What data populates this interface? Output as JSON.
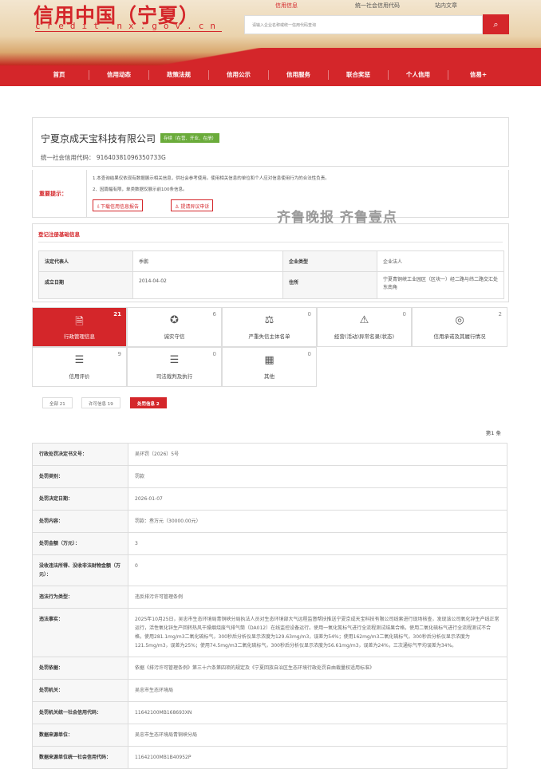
{
  "header": {
    "logo": "信用中国（宁夏）",
    "logo_sub": "credit.nx.gov.cn",
    "search_tabs": [
      "信用信息",
      "统一社会信用代码",
      "站内文章"
    ],
    "search_placeholder": "请输入企业名称或统一信用代码查询"
  },
  "nav": [
    "首页",
    "信用动态",
    "政策法规",
    "信用公示",
    "信用服务",
    "联合奖惩",
    "个人信用",
    "信易+"
  ],
  "company": {
    "name": "宁夏京成天宝科技有限公司",
    "status": "存续（在营、开业、在册）",
    "code_label": "统一社会信用代码：",
    "code": "91640381096350733G"
  },
  "notice": {
    "label": "重要提示：",
    "lines": [
      "1.本查询结果仅依现有数据展示相关信息，供社会参考使用。使用相关信息的单位和个人应对信息使用行为的合法性负责。",
      "2、因篇幅有限，单类数据仅展示前100条信息。"
    ],
    "download": "下载信用信息报告",
    "objection": "提请异议申诉"
  },
  "watermark": "齐鲁晚报  齐鲁壹点",
  "basic": {
    "title": "登记注册基础信息",
    "rows": [
      [
        "法定代表人",
        "季鹏",
        "企业类型",
        "企业法人"
      ],
      [
        "成立日期",
        "2014-04-02",
        "住所",
        "宁夏青铜峡工业园区（区块一）经二路与纬二路交汇处东南角"
      ]
    ]
  },
  "tiles": [
    {
      "label": "行政管理信息",
      "count": "21",
      "icon": "document-person-icon"
    },
    {
      "label": "诚实守信",
      "count": "6",
      "icon": "medal-icon"
    },
    {
      "label": "严重失信主体名单",
      "count": "0",
      "icon": "gavel-icon"
    },
    {
      "label": "经营(活动)异常名录(状态)",
      "count": "0",
      "icon": "alarm-icon"
    },
    {
      "label": "信用承诺及其履行情况",
      "count": "2",
      "icon": "target-icon"
    },
    {
      "label": "信用评价",
      "count": "9",
      "icon": "person-list-icon"
    },
    {
      "label": "司法裁判及执行",
      "count": "0",
      "icon": "person-list-icon"
    },
    {
      "label": "其他",
      "count": "0",
      "icon": "file-grid-icon"
    }
  ],
  "filters": [
    "全部 21",
    "许可信息 19",
    "处罚信息 2"
  ],
  "page_label": "第1 条",
  "detail": [
    [
      "行政处罚决定书文号：",
      "吴环罚〔2026〕5号"
    ],
    [
      "处罚类别：",
      "罚款"
    ],
    [
      "处罚决定日期：",
      "2026-01-07"
    ],
    [
      "处罚内容：",
      "罚款：叁万元（30000.00元）"
    ],
    [
      "处罚金额（万元）：",
      "3"
    ],
    [
      "没收违法所得、没收非法财物金额（万元）：",
      "0"
    ],
    [
      "违法行为类型：",
      "违反排污许可管理条例"
    ],
    [
      "违法事实：",
      "2025年10月25日，吴忠市生态环境局青铜峡分局执法人员对生态环境部大气远程监督帮扶推送宁夏京成天宝科技有限公司线索进行现场核查，发现该公司氧化锌生产线正常运行，活性氧化锌生产回转热风干燥烟烧废气排气筒（DA012）在线监控设备运行。使用一氧化氮标气进行全流程测试结果合格，使用二氧化硫标气进行全流程测试不合格，使用281.1mg/m3二氧化硫标气，300秒后分析仪显示浓度为129.63mg/m3，误差为54%；使用162mg/m3二氧化硫标气，300秒后分析仪显示浓度为121.5mg/m3，误差为25%；使用74.5mg/m3二氧化硫标气，300秒后分析仪显示浓度为56.61mg/m3，误差为24%，三次通标气平均误差为34%。"
    ],
    [
      "处罚依据：",
      "依据《排污许可管理条例》第三十六条第四项的规定及《宁夏回族自治区生态环境行政处罚自由裁量权适用标准》"
    ],
    [
      "处罚机关：",
      "吴忠市生态环境局"
    ],
    [
      "处罚机关统一社会信用代码：",
      "11642100MB168693XN"
    ],
    [
      "数据来源单位：",
      "吴忠市生态环境局青铜峡分局"
    ],
    [
      "数据来源单位统一社会信用代码：",
      "11642100MB1B40952P"
    ]
  ]
}
